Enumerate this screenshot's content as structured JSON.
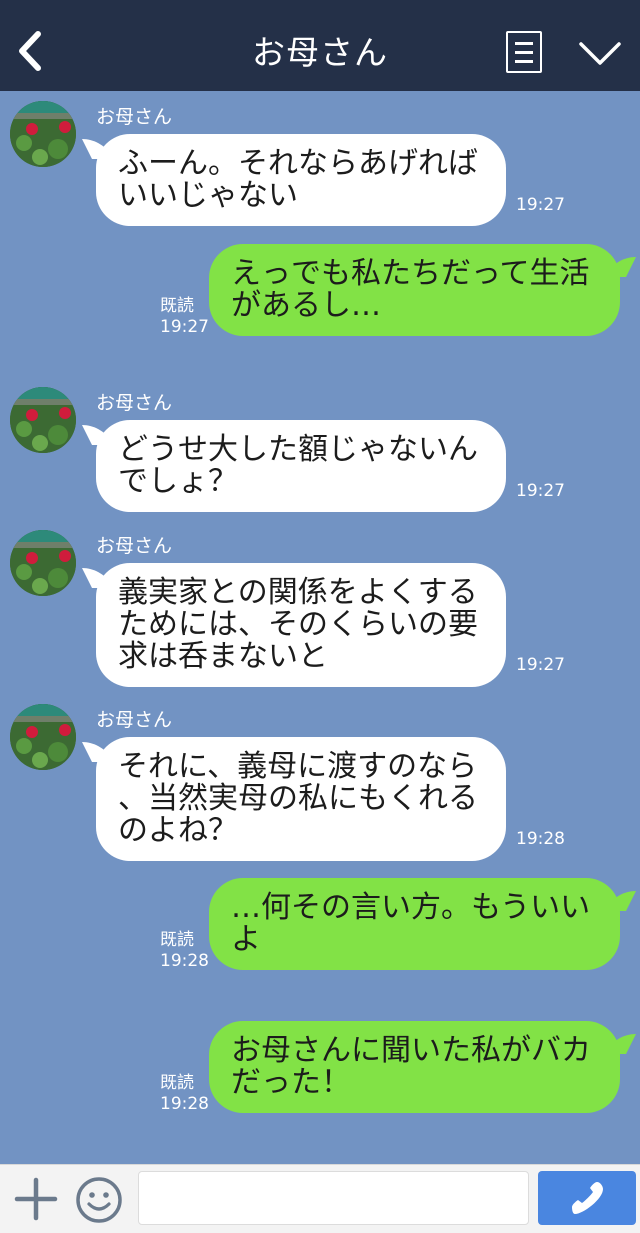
{
  "header": {
    "title": "お母さん"
  },
  "messages": [
    {
      "sender": "お母さん",
      "lines": [
        "ふーん。それならあげれば",
        "いいじゃない"
      ],
      "time": "19:27"
    },
    {
      "lines": [
        "えっでも私たちだって生活",
        "があるし…"
      ],
      "read": "既読",
      "time": "19:27"
    },
    {
      "sender": "お母さん",
      "lines": [
        "どうせ大した額じゃないん",
        "でしょ？"
      ],
      "time": "19:27"
    },
    {
      "sender": "お母さん",
      "lines": [
        "義実家との関係をよくする",
        "ためには、そのくらいの要",
        "求は呑まないと"
      ],
      "time": "19:27"
    },
    {
      "sender": "お母さん",
      "lines": [
        "それに、義母に渡すのなら",
        "、当然実母の私にもくれる",
        "のよね？"
      ],
      "time": "19:28"
    },
    {
      "lines": [
        "…何その言い方。もういい",
        "よ"
      ],
      "read": "既読",
      "time": "19:28"
    },
    {
      "lines": [
        "お母さんに聞いた私がバカ",
        "だった！"
      ],
      "read": "既読",
      "time": "19:28"
    }
  ],
  "colors": {
    "header_bg": "#243048",
    "chat_bg": "#7293c3",
    "incoming_bubble": "#ffffff",
    "outgoing_bubble": "#82e246",
    "send_button": "#4a86e0"
  },
  "icons": {
    "back": "chevron-left-icon",
    "menu": "menu-icon",
    "collapse": "chevron-down-icon",
    "plus": "plus-icon",
    "emoji": "smiley-icon",
    "send": "phone-icon"
  }
}
